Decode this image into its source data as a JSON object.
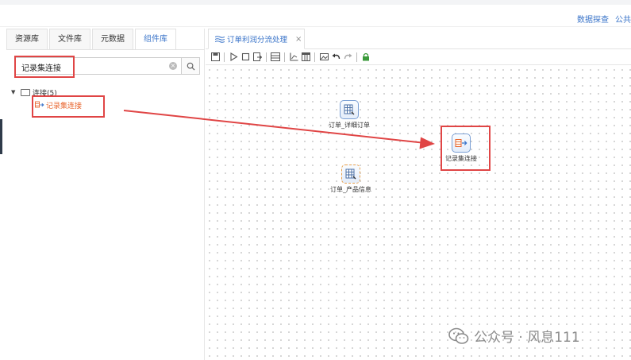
{
  "header": {
    "links": [
      "数据探查",
      "公共"
    ]
  },
  "left_panel": {
    "tabs": [
      {
        "label": "资源库",
        "active": false
      },
      {
        "label": "文件库",
        "active": false
      },
      {
        "label": "元数据",
        "active": false
      },
      {
        "label": "组件库",
        "active": true
      }
    ],
    "search": {
      "value": "记录集连接",
      "clear_icon": "clear-circle-icon",
      "button_icon": "search-icon"
    },
    "tree": {
      "root_label": "连接(5)",
      "child_label": "记录集连接"
    }
  },
  "editor": {
    "tab_label": "订单利润分流处理",
    "tab_icon": "flow-icon",
    "close_symbol": "×",
    "toolbar_icons": [
      "save-icon",
      "run-icon",
      "stop-icon",
      "export-icon",
      "grid-icon",
      "chart-icon",
      "table-icon",
      "image-icon",
      "undo-icon",
      "redo-icon",
      "lock-icon"
    ]
  },
  "canvas": {
    "nodes": [
      {
        "label": "订单_详细订单"
      },
      {
        "label": "订单_产品信息"
      },
      {
        "label": "记录集连接"
      }
    ]
  },
  "watermark": {
    "text": "公众号 · 风息111",
    "icon": "wechat-icon"
  },
  "colors": {
    "accent": "#3a74c9",
    "highlight": "#e04545",
    "tree_selected": "#e8632b"
  }
}
